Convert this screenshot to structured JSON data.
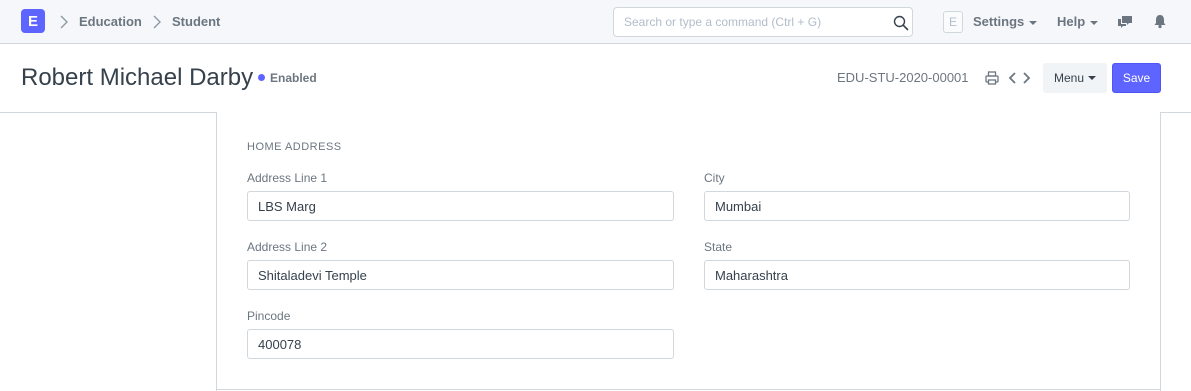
{
  "navbar": {
    "logo_letter": "E",
    "breadcrumbs": [
      "Education",
      "Student"
    ],
    "search_placeholder": "Search or type a command (Ctrl + G)",
    "avatar_letter": "E",
    "settings_label": "Settings",
    "help_label": "Help"
  },
  "page": {
    "title": "Robert Michael Darby",
    "status": "Enabled",
    "doc_name": "EDU-STU-2020-00001",
    "menu_label": "Menu",
    "save_label": "Save"
  },
  "form": {
    "section_title": "HOME ADDRESS",
    "fields": {
      "address_line_1": {
        "label": "Address Line 1",
        "value": "LBS Marg"
      },
      "address_line_2": {
        "label": "Address Line 2",
        "value": "Shitaladevi Temple"
      },
      "pincode": {
        "label": "Pincode",
        "value": "400078"
      },
      "city": {
        "label": "City",
        "value": "Mumbai"
      },
      "state": {
        "label": "State",
        "value": "Maharashtra"
      }
    }
  },
  "colors": {
    "accent": "#5e64ff",
    "navbar_bg": "#f5f7fa",
    "border": "#d1d8dd",
    "text": "#36414c",
    "muted_text": "#6c7680"
  },
  "icons": [
    "chevron-right-icon",
    "search-icon",
    "chat-icon",
    "bell-icon",
    "printer-icon",
    "chevron-left-icon"
  ]
}
